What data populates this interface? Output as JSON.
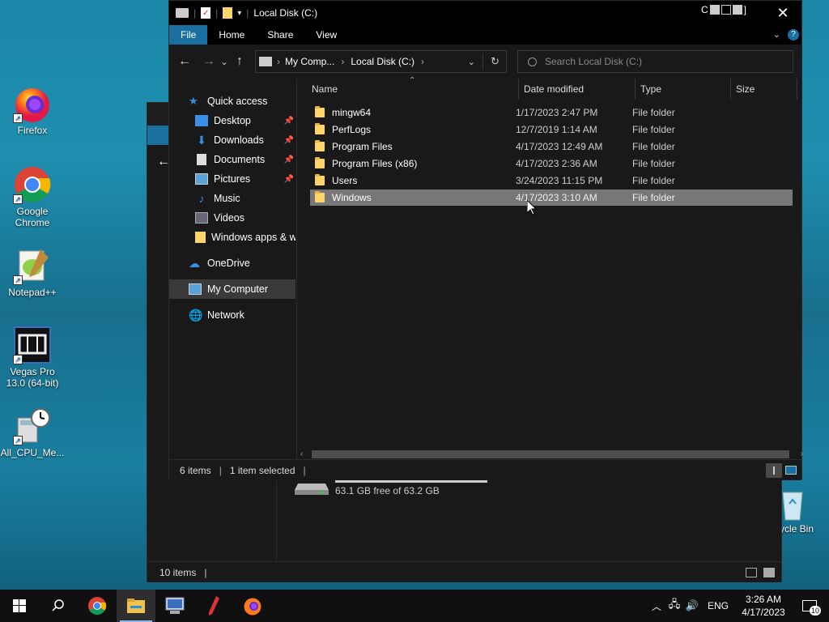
{
  "desktop": {
    "icons": [
      {
        "label": "Firefox"
      },
      {
        "label": "Google Chrome"
      },
      {
        "label": "Notepad++"
      },
      {
        "label": "Vegas Pro 13.0 (64-bit)"
      },
      {
        "label": "All_CPU_Me..."
      },
      {
        "label": "ycle Bin"
      }
    ]
  },
  "back_window": {
    "status_count": "10 items",
    "drive_free": "63.1 GB free of 63.2 GB"
  },
  "explorer": {
    "title": "Local Disk (C:)",
    "title_right_glyphs": "C",
    "ribbon_tabs": [
      "File",
      "Home",
      "Share",
      "View"
    ],
    "breadcrumb": [
      "My Comp...",
      "Local Disk (C:)"
    ],
    "search_placeholder": "Search Local Disk (C:)",
    "nav": {
      "quick_access": "Quick access",
      "items": [
        {
          "label": "Desktop",
          "pinned": true
        },
        {
          "label": "Downloads",
          "pinned": true
        },
        {
          "label": "Documents",
          "pinned": true
        },
        {
          "label": "Pictures",
          "pinned": true
        },
        {
          "label": "Music",
          "pinned": false
        },
        {
          "label": "Videos",
          "pinned": false
        },
        {
          "label": "Windows apps & w",
          "pinned": false
        }
      ],
      "onedrive": "OneDrive",
      "my_computer": "My Computer",
      "network": "Network"
    },
    "columns": [
      "Name",
      "Date modified",
      "Type",
      "Size"
    ],
    "rows": [
      {
        "name": "mingw64",
        "date": "1/17/2023 2:47 PM",
        "type": "File folder"
      },
      {
        "name": "PerfLogs",
        "date": "12/7/2019 1:14 AM",
        "type": "File folder"
      },
      {
        "name": "Program Files",
        "date": "4/17/2023 12:49 AM",
        "type": "File folder"
      },
      {
        "name": "Program Files (x86)",
        "date": "4/17/2023 2:36 AM",
        "type": "File folder"
      },
      {
        "name": "Users",
        "date": "3/24/2023 11:15 PM",
        "type": "File folder"
      },
      {
        "name": "Windows",
        "date": "4/17/2023 3:10 AM",
        "type": "File folder",
        "selected": true
      }
    ],
    "status": {
      "count": "6 items",
      "selected": "1 item selected"
    }
  },
  "taskbar": {
    "language": "ENG",
    "time": "3:26 AM",
    "date": "4/17/2023",
    "notification_count": "10"
  },
  "colors": {
    "accent": "#1a6fa1",
    "folder": "#ffd56b",
    "selection": "#777777"
  }
}
